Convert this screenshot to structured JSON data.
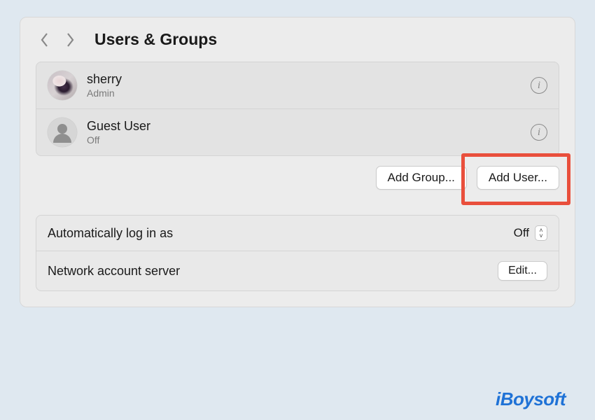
{
  "header": {
    "title": "Users & Groups"
  },
  "users": [
    {
      "name": "sherry",
      "role": "Admin"
    },
    {
      "name": "Guest User",
      "role": "Off"
    }
  ],
  "buttons": {
    "add_group": "Add Group...",
    "add_user": "Add User..."
  },
  "settings": {
    "auto_login_label": "Automatically log in as",
    "auto_login_value": "Off",
    "network_server_label": "Network account server",
    "edit_label": "Edit..."
  },
  "watermark": "iBoysoft"
}
